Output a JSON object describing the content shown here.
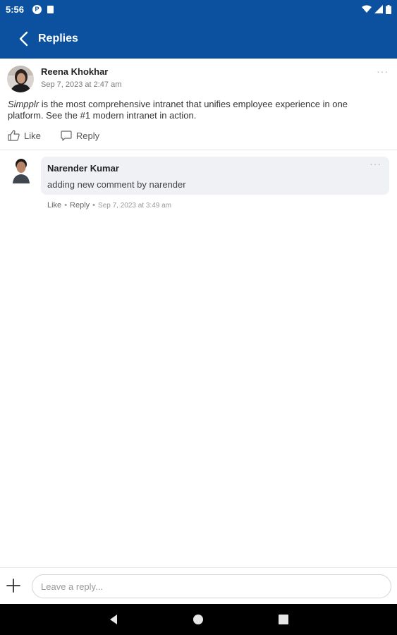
{
  "status_bar": {
    "time": "5:56"
  },
  "app_bar": {
    "title": "Replies"
  },
  "post": {
    "author": "Reena Khokhar",
    "timestamp": "Sep 7, 2023 at 2:47 am",
    "brand": "Simpplr",
    "body": " is the most comprehensive intranet that unifies employee experience in one platform. See the #1 modern intranet in action.",
    "like_label": "Like",
    "reply_label": "Reply",
    "more": "···"
  },
  "comment": {
    "author": "Narender Kumar",
    "text": "adding new comment by narender",
    "like_label": "Like",
    "reply_label": "Reply",
    "separator": "•",
    "timestamp": "Sep 7, 2023 at 3:49 am",
    "more": "···"
  },
  "reply_bar": {
    "placeholder": "Leave a reply..."
  },
  "colors": {
    "brand": "#0b51a0",
    "bubble": "#f0f1f5"
  }
}
